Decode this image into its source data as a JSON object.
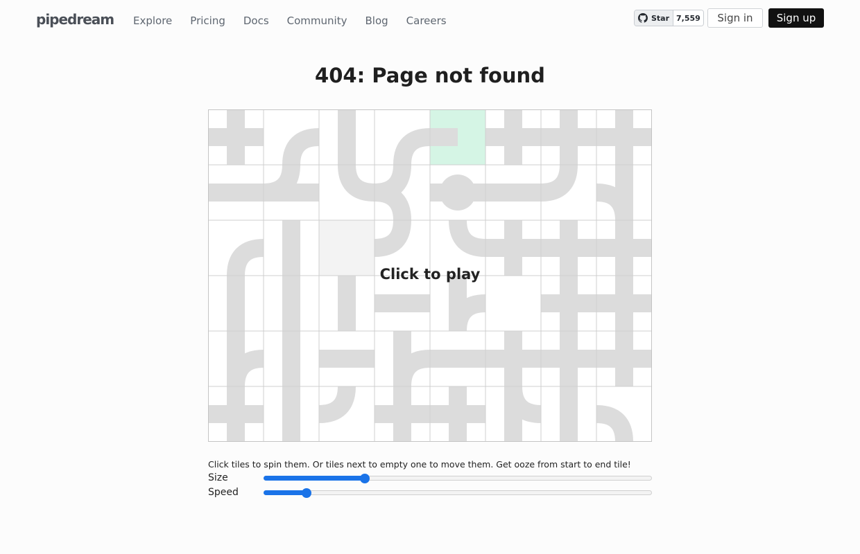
{
  "header": {
    "logo": "pipedream",
    "nav": [
      "Explore",
      "Pricing",
      "Docs",
      "Community",
      "Blog",
      "Careers"
    ],
    "github": {
      "icon": "github-icon",
      "star_label": "Star",
      "count": "7,559"
    },
    "sign_in": "Sign in",
    "sign_up": "Sign up"
  },
  "main": {
    "title": "404: Page not found",
    "play_label": "Click to play",
    "instructions": "Click tiles to spin them. Or tiles next to empty one to move them. Get ooze from start to end tile!",
    "controls": {
      "size": {
        "label": "Size",
        "value": 0.26
      },
      "speed": {
        "label": "Speed",
        "value": 0.11
      }
    }
  },
  "colors": {
    "pipe": "#dcdcdc",
    "start_tile": "#d5f5e5",
    "empty_tile": "#f3f3f3",
    "slider_accent": "#1a73e8"
  }
}
